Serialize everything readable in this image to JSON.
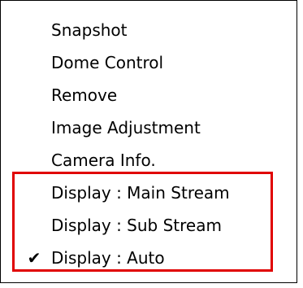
{
  "menu": {
    "items": [
      {
        "label": "Snapshot",
        "checked": false
      },
      {
        "label": "Dome Control",
        "checked": false
      },
      {
        "label": "Remove",
        "checked": false
      },
      {
        "label": "Image Adjustment",
        "checked": false
      },
      {
        "label": "Camera Info.",
        "checked": false
      },
      {
        "label": "Display : Main Stream",
        "checked": false
      },
      {
        "label": "Display : Sub Stream",
        "checked": false
      },
      {
        "label": "Display : Auto",
        "checked": true
      }
    ],
    "check_glyph": "✔"
  },
  "colors": {
    "highlight_border": "#e00000",
    "menu_border": "#000000",
    "background": "#ffffff",
    "text": "#000000"
  }
}
